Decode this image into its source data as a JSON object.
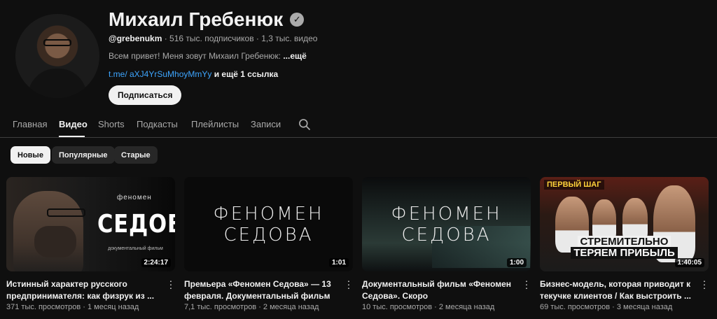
{
  "channel": {
    "name": "Михаил Гребенюк",
    "handle": "@grebenukm",
    "subscribers": " · 516 тыс. подписчиков · 1,3 тыс. видео",
    "description": "Всем привет! Меня зовут Михаил Гребенюк: ",
    "description_more": "...ещё",
    "link": "t.me/ aXJ4YrSuMhoyMmYy",
    "link_extra": " и ещё 1 ссылка",
    "subscribe_label": "Подписаться"
  },
  "tabs": [
    "Главная",
    "Видео",
    "Shorts",
    "Подкасты",
    "Плейлисты",
    "Записи"
  ],
  "active_tab": "Видео",
  "chips": [
    "Новые",
    "Популярные",
    "Старые"
  ],
  "active_chip": "Новые",
  "icons": {
    "search": "search-icon",
    "verified": "verified-icon",
    "more": "more-vert-icon"
  },
  "videos": [
    {
      "title": "Истинный характер русского предпринимателя: как физрук из ...",
      "stats": "371 тыс. просмотров · 1 месяц назад",
      "duration": "2:24:17",
      "thumb_small": "феномен",
      "thumb_big": "СЕДОВА",
      "thumb_doc": "документальный фильм"
    },
    {
      "title": "Премьера «Феномен Седова» — 13 февраля. Документальный фильм ...",
      "stats": "7,1 тыс. просмотров · 2 месяца назад",
      "duration": "1:01",
      "thumb_text": "ФЕНОМЕН СЕДОВА"
    },
    {
      "title": "Документальный фильм «Феномен Седова». Скоро",
      "stats": "10 тыс. просмотров · 2 месяца назад",
      "duration": "1:00",
      "thumb_text": "ФЕНОМЕН СЕДОВА"
    },
    {
      "title": "Бизнес-модель, которая приводит к текучке клиентов / Как выстроить ...",
      "stats": "69 тыс. просмотров · 3 месяца назад",
      "duration": "1:40:05",
      "thumb_badge": "ПЕРВЫЙ ШАГ",
      "thumb_line1": "СТРЕМИТЕЛЬНО",
      "thumb_line2": "ТЕРЯЕМ ПРИБЫЛЬ"
    }
  ]
}
